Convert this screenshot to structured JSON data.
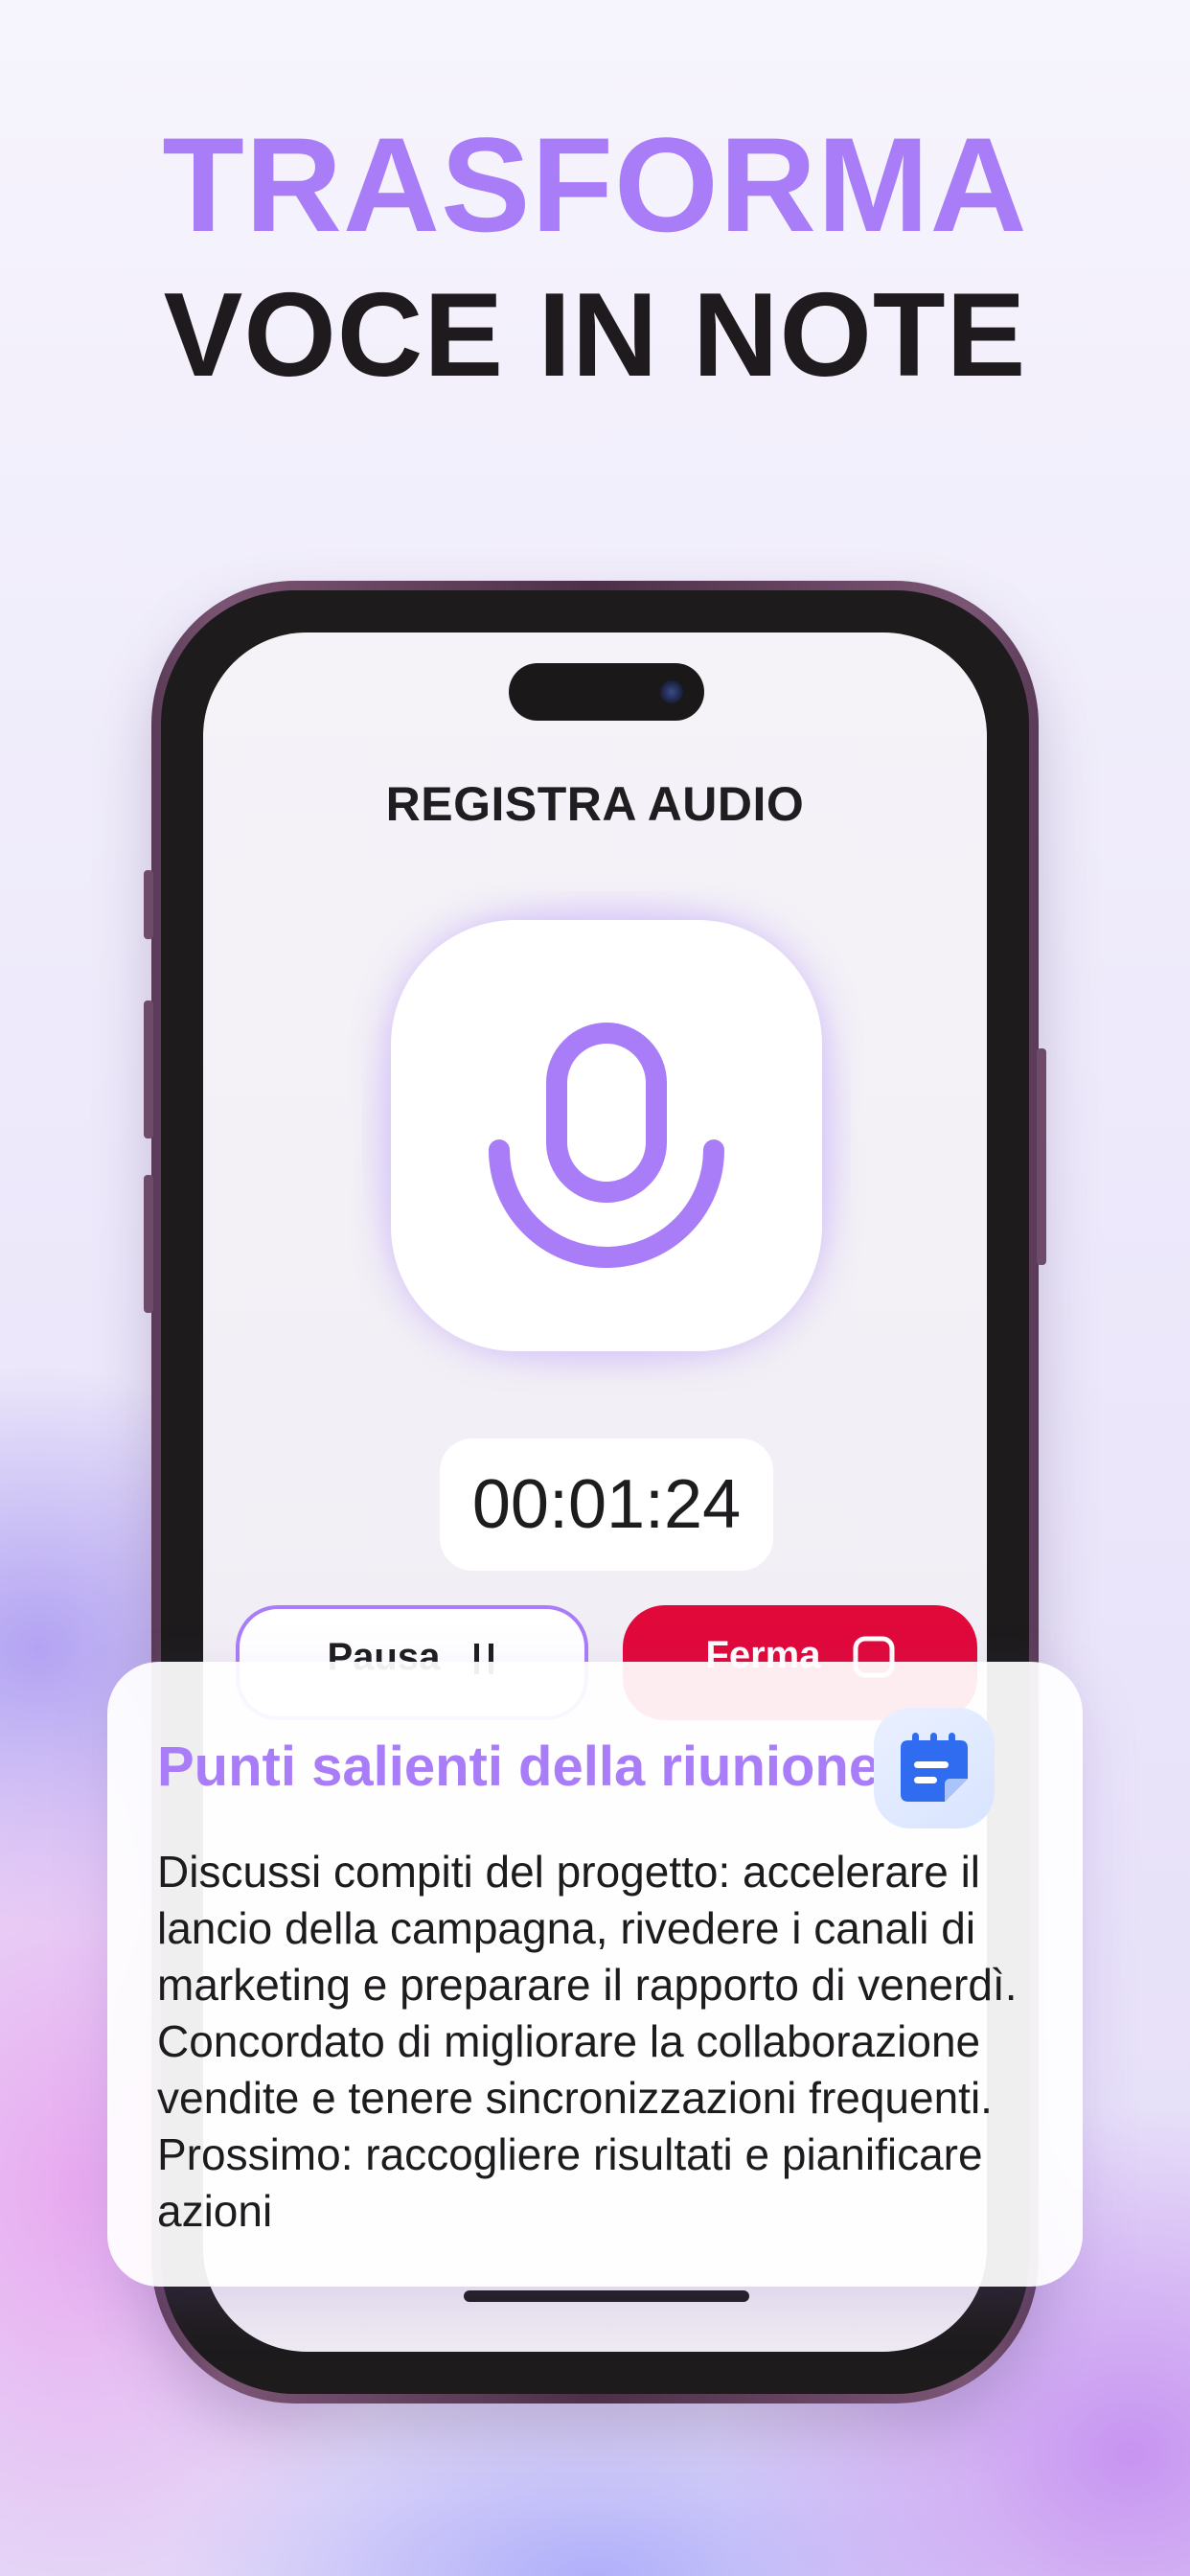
{
  "headline": {
    "line1": "TRASFORMA",
    "line2": "VOCE IN NOTE"
  },
  "screen": {
    "title": "REGISTRA AUDIO",
    "timer": "00:01:24",
    "pause_label": "Pausa",
    "stop_label": "Ferma"
  },
  "card": {
    "title": "Punti salienti della riunione",
    "body": "Discussi compiti del progetto: accelerare il lancio della campagna, rivedere i canali di marketing e preparare il rapporto di venerdì. Concordato di migliorare la collaborazione vendite e tenere sincronizzazioni frequenti. Prossimo: raccogliere risultati e pianificare azioni"
  },
  "colors": {
    "accent": "#a97cf8",
    "stop": "#e1083a",
    "notes_icon": "#2f6cf0"
  },
  "icons": [
    "microphone-icon",
    "pause-icon",
    "stop-icon",
    "notes-icon"
  ]
}
